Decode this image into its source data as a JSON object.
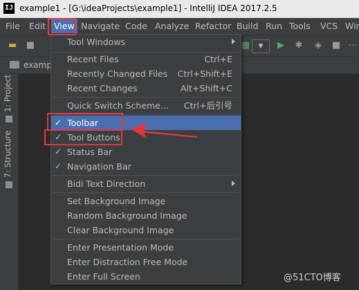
{
  "window": {
    "title": "example1 - [G:\\ideaProjects\\example1] - IntelliJ IDEA 2017.2.5",
    "app_icon": "IJ"
  },
  "menubar": [
    "File",
    "Edit",
    "View",
    "Navigate",
    "Code",
    "Analyze",
    "Refactor",
    "Build",
    "Run",
    "Tools",
    "VCS",
    "Windo"
  ],
  "navbar": {
    "crumb": "example"
  },
  "side_tabs": {
    "project": "1: Project",
    "structure": "7: Structure"
  },
  "view_menu": {
    "tool_windows": "Tool Windows",
    "recent_files": {
      "label": "Recent Files",
      "shortcut": "Ctrl+E"
    },
    "recently_changed": {
      "label": "Recently Changed Files",
      "shortcut": "Ctrl+Shift+E"
    },
    "recent_changes": {
      "label": "Recent Changes",
      "shortcut": "Alt+Shift+C"
    },
    "quick_switch": {
      "label": "Quick Switch Scheme...",
      "shortcut": "Ctrl+后引号"
    },
    "toolbar": "Toolbar",
    "tool_buttons": "Tool Buttons",
    "status_bar": "Status Bar",
    "navigation_bar": "Navigation Bar",
    "bidi": "Bidi Text Direction",
    "set_bg": "Set Background Image",
    "random_bg": "Random Background Image",
    "clear_bg": "Clear Background Image",
    "presentation": "Enter Presentation Mode",
    "distraction": "Enter Distraction Free Mode",
    "full_screen": "Enter Full Screen",
    "check_mark": "✓"
  },
  "colors": {
    "highlight": "#4b6eaf",
    "annotation": "#e8343c",
    "menu_bg": "#3c3f41"
  },
  "watermark": "@51CTO博客"
}
